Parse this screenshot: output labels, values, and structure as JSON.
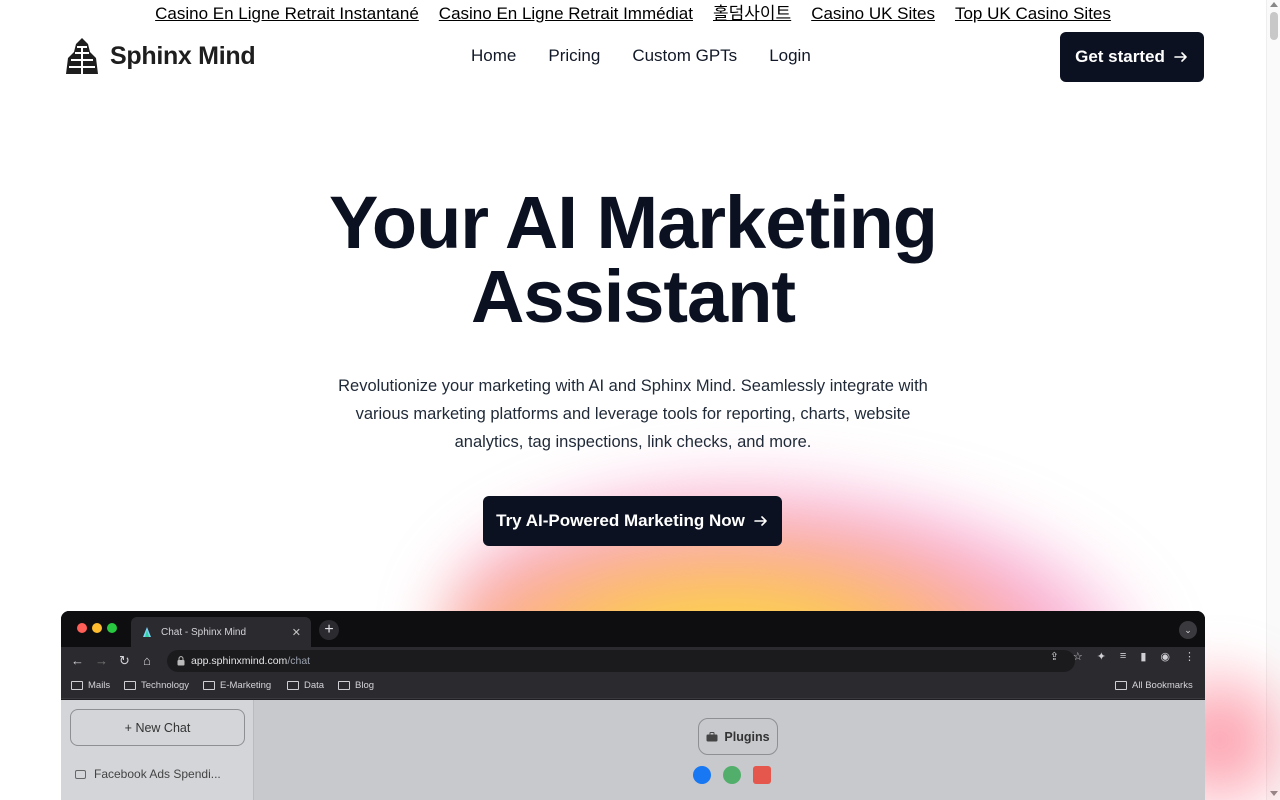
{
  "top_links": [
    "Casino En Ligne Retrait Instantané",
    "Casino En Ligne Retrait Immédiat",
    "홀덤사이트",
    "Casino UK Sites",
    "Top UK Casino Sites"
  ],
  "brand": {
    "name": "Sphinx Mind"
  },
  "nav": {
    "items": [
      "Home",
      "Pricing",
      "Custom GPTs",
      "Login"
    ],
    "cta_label": "Get started"
  },
  "hero": {
    "title_line1": "Your AI Marketing",
    "title_line2": "Assistant",
    "subtitle": "Revolutionize your marketing with AI and Sphinx Mind. Seamlessly integrate with various marketing platforms and leverage tools for reporting, charts, website analytics, tag inspections, link checks, and more.",
    "cta_label": "Try AI-Powered Marketing Now"
  },
  "screenshot": {
    "tab_title": "Chat - Sphinx Mind",
    "url_domain": "app.sphinxmind.com",
    "url_path": "/chat",
    "bookmarks": [
      "Mails",
      "Technology",
      "E-Marketing",
      "Data",
      "Blog"
    ],
    "all_bookmarks_label": "All Bookmarks",
    "new_chat_label": "+ New Chat",
    "chat_items": [
      "Facebook Ads Spendi..."
    ],
    "plugins_label": "Plugins"
  },
  "colors": {
    "primary": "#0b1120",
    "text": "#1f2937"
  }
}
